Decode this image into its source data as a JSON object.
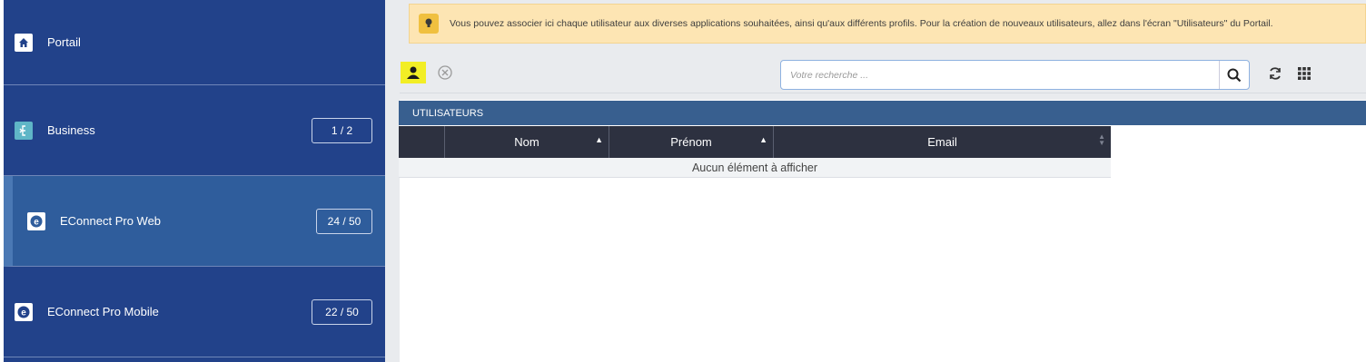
{
  "sidebar": {
    "items": [
      {
        "label": "Portail",
        "icon": "home-icon",
        "badge": ""
      },
      {
        "label": "Business",
        "icon": "business-icon",
        "badge": "1 / 2"
      },
      {
        "label": "EConnect Pro Web",
        "icon": "econnect-icon",
        "badge": "24 / 50"
      },
      {
        "label": "EConnect Pro Mobile",
        "icon": "econnect-icon",
        "badge": "22 / 50"
      }
    ],
    "colors": {
      "bg": "#22428a",
      "active": "#2f5d9c"
    }
  },
  "info": {
    "message": "Vous pouvez associer ici chaque utilisateur aux diverses applications souhaitées, ainsi qu'aux différents profils. Pour la création de nouveaux utilisateurs, allez dans l'écran \"Utilisateurs\" du Portail."
  },
  "search": {
    "placeholder": "Votre recherche ...",
    "value": ""
  },
  "panel": {
    "title": "UTILISATEURS",
    "columns": [
      "",
      "Nom",
      "Prénom",
      "Email"
    ],
    "empty_text": "Aucun élément à afficher"
  }
}
